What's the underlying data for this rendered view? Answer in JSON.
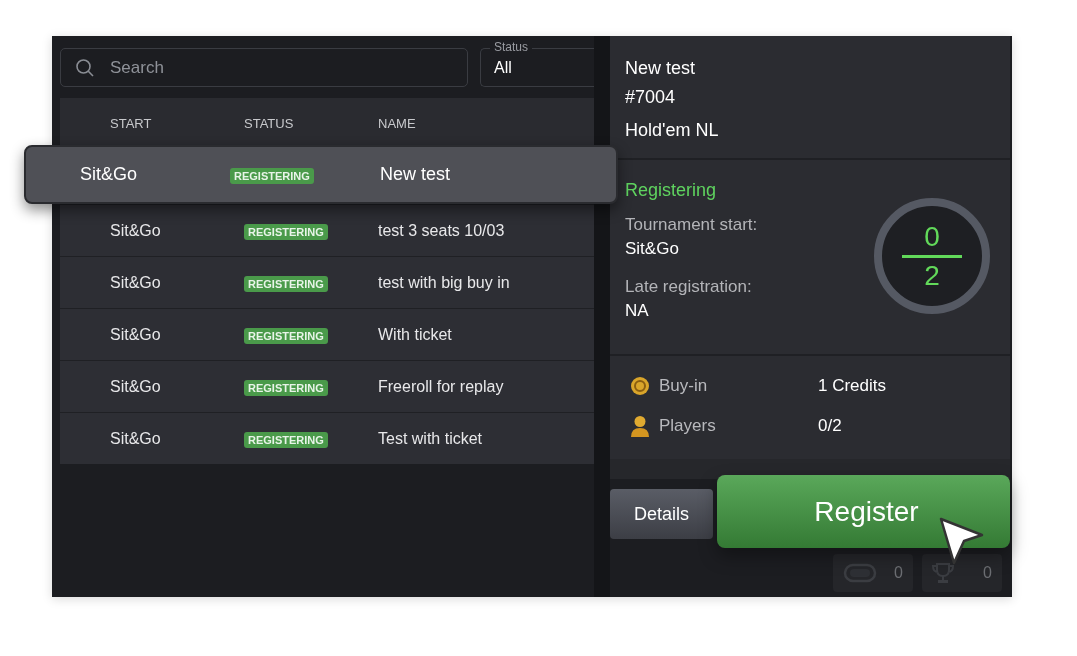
{
  "search": {
    "placeholder": "Search"
  },
  "status_filter": {
    "label": "Status",
    "value": "All"
  },
  "table": {
    "columns": [
      "START",
      "STATUS",
      "NAME"
    ],
    "rows": [
      {
        "start": "Sit&Go",
        "status": "REGISTERING",
        "name": "New test",
        "selected": true
      },
      {
        "start": "Sit&Go",
        "status": "REGISTERING",
        "name": "test 3 seats 10/03",
        "selected": false
      },
      {
        "start": "Sit&Go",
        "status": "REGISTERING",
        "name": "test with big buy in",
        "selected": false
      },
      {
        "start": "Sit&Go",
        "status": "REGISTERING",
        "name": "With ticket",
        "selected": false
      },
      {
        "start": "Sit&Go",
        "status": "REGISTERING",
        "name": "Freeroll for replay",
        "selected": false
      },
      {
        "start": "Sit&Go",
        "status": "REGISTERING",
        "name": "Test with ticket",
        "selected": false
      }
    ]
  },
  "details": {
    "name": "New test",
    "id": "#7004",
    "game": "Hold'em NL",
    "state": "Registering",
    "start_label": "Tournament start:",
    "start_value": "Sit&Go",
    "late_label": "Late registration:",
    "late_value": "NA",
    "registered": "0",
    "seats": "2",
    "info": [
      {
        "kind": "coin",
        "label": "Buy-in",
        "value": "1 Credits"
      },
      {
        "kind": "person",
        "label": "Players",
        "value": "0/2"
      }
    ]
  },
  "buttons": [
    {
      "kind": "secondary",
      "label": "Details"
    },
    {
      "kind": "primary",
      "label": "Register"
    }
  ],
  "counters": [
    {
      "kind": "chip",
      "value": "0"
    },
    {
      "kind": "trophy",
      "value": "0"
    }
  ]
}
